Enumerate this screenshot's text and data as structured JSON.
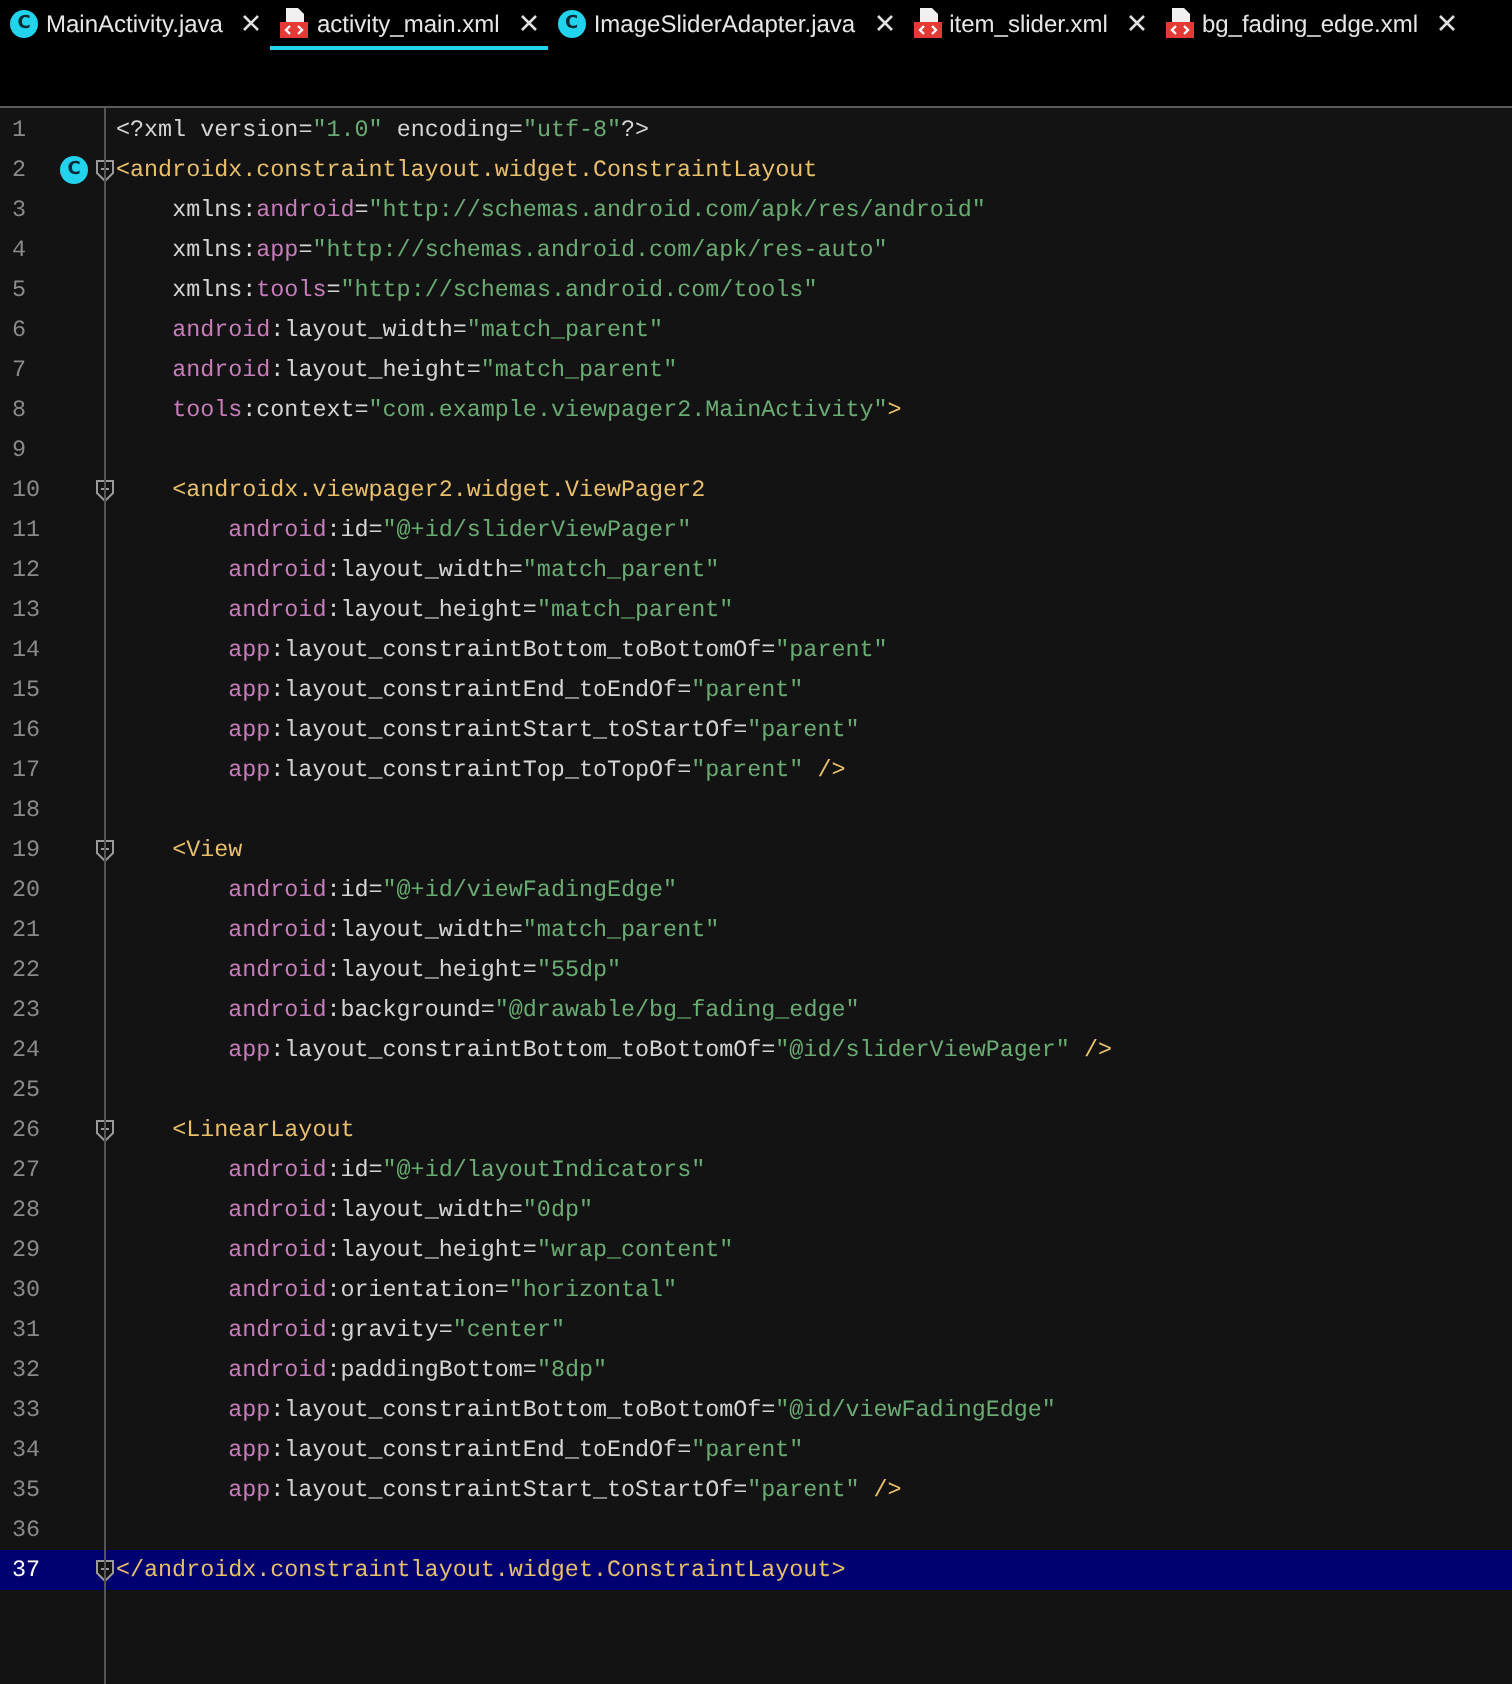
{
  "tabs": [
    {
      "label": "MainActivity.java",
      "kind": "java",
      "icon_letter": "C",
      "selected": false
    },
    {
      "label": "activity_main.xml",
      "kind": "xml",
      "selected": true
    },
    {
      "label": "ImageSliderAdapter.java",
      "kind": "java",
      "icon_letter": "C",
      "selected": false
    },
    {
      "label": "item_slider.xml",
      "kind": "xml",
      "selected": false
    },
    {
      "label": "bg_fading_edge.xml",
      "kind": "xml",
      "selected": false
    }
  ],
  "editor": {
    "lines": [
      {
        "number": "1",
        "text": "<?xml version=\"1.0\" encoding=\"utf-8\"?>",
        "fold": false,
        "selected": false
      },
      {
        "number": "2",
        "text": "<androidx.constraintlayout.widget.ConstraintLayout",
        "fold": true,
        "gutter_letter": "C",
        "selected": false
      },
      {
        "number": "3",
        "text": "    xmlns:android=\"http://schemas.android.com/apk/res/android\"",
        "fold": false,
        "selected": false
      },
      {
        "number": "4",
        "text": "    xmlns:app=\"http://schemas.android.com/apk/res-auto\"",
        "fold": false,
        "selected": false
      },
      {
        "number": "5",
        "text": "    xmlns:tools=\"http://schemas.android.com/tools\"",
        "fold": false,
        "selected": false
      },
      {
        "number": "6",
        "text": "    android:layout_width=\"match_parent\"",
        "fold": false,
        "selected": false
      },
      {
        "number": "7",
        "text": "    android:layout_height=\"match_parent\"",
        "fold": false,
        "selected": false
      },
      {
        "number": "8",
        "text": "    tools:context=\"com.example.viewpager2.MainActivity\">",
        "fold": false,
        "selected": false
      },
      {
        "number": "9",
        "fold": false,
        "selected": false
      },
      {
        "number": "10",
        "text": "    <androidx.viewpager2.widget.ViewPager2",
        "fold": true,
        "selected": false
      },
      {
        "number": "11",
        "text": "        android:id=\"@+id/sliderViewPager\"",
        "fold": false,
        "selected": false
      },
      {
        "number": "12",
        "text": "        android:layout_width=\"match_parent\"",
        "fold": false,
        "selected": false
      },
      {
        "number": "13",
        "text": "        android:layout_height=\"match_parent\"",
        "fold": false,
        "selected": false
      },
      {
        "number": "14",
        "text": "        app:layout_constraintBottom_toBottomOf=\"parent\"",
        "fold": false,
        "selected": false
      },
      {
        "number": "15",
        "text": "        app:layout_constraintEnd_toEndOf=\"parent\"",
        "fold": false,
        "selected": false
      },
      {
        "number": "16",
        "text": "        app:layout_constraintStart_toStartOf=\"parent\"",
        "fold": false,
        "selected": false
      },
      {
        "number": "17",
        "text": "        app:layout_constraintTop_toTopOf=\"parent\" />",
        "fold": false,
        "selected": false
      },
      {
        "number": "18",
        "fold": false,
        "selected": false
      },
      {
        "number": "19",
        "text": "    <View",
        "fold": true,
        "selected": false
      },
      {
        "number": "20",
        "text": "        android:id=\"@+id/viewFadingEdge\"",
        "fold": false,
        "selected": false
      },
      {
        "number": "21",
        "text": "        android:layout_width=\"match_parent\"",
        "fold": false,
        "selected": false
      },
      {
        "number": "22",
        "text": "        android:layout_height=\"55dp\"",
        "fold": false,
        "selected": false
      },
      {
        "number": "23",
        "text": "        android:background=\"@drawable/bg_fading_edge\"",
        "fold": false,
        "selected": false
      },
      {
        "number": "24",
        "text": "        app:layout_constraintBottom_toBottomOf=\"@id/sliderViewPager\" />",
        "fold": false,
        "selected": false
      },
      {
        "number": "25",
        "fold": false,
        "selected": false
      },
      {
        "number": "26",
        "text": "    <LinearLayout",
        "fold": true,
        "selected": false
      },
      {
        "number": "27",
        "text": "        android:id=\"@+id/layoutIndicators\"",
        "fold": false,
        "selected": false
      },
      {
        "number": "28",
        "text": "        android:layout_width=\"0dp\"",
        "fold": false,
        "selected": false
      },
      {
        "number": "29",
        "text": "        android:layout_height=\"wrap_content\"",
        "fold": false,
        "selected": false
      },
      {
        "number": "30",
        "text": "        android:orientation=\"horizontal\"",
        "fold": false,
        "selected": false
      },
      {
        "number": "31",
        "text": "        android:gravity=\"center\"",
        "fold": false,
        "selected": false
      },
      {
        "number": "32",
        "text": "        android:paddingBottom=\"8dp\"",
        "fold": false,
        "selected": false
      },
      {
        "number": "33",
        "text": "        app:layout_constraintBottom_toBottomOf=\"@id/viewFadingEdge\"",
        "fold": false,
        "selected": false
      },
      {
        "number": "34",
        "text": "        app:layout_constraintEnd_toEndOf=\"parent\"",
        "fold": false,
        "selected": false
      },
      {
        "number": "35",
        "text": "        app:layout_constraintStart_toStartOf=\"parent\" />",
        "fold": false,
        "selected": false
      },
      {
        "number": "36",
        "fold": false,
        "selected": false
      },
      {
        "number": "37",
        "text": "</androidx.constraintlayout.widget.ConstraintLayout>",
        "fold": true,
        "selected": true
      }
    ]
  }
}
